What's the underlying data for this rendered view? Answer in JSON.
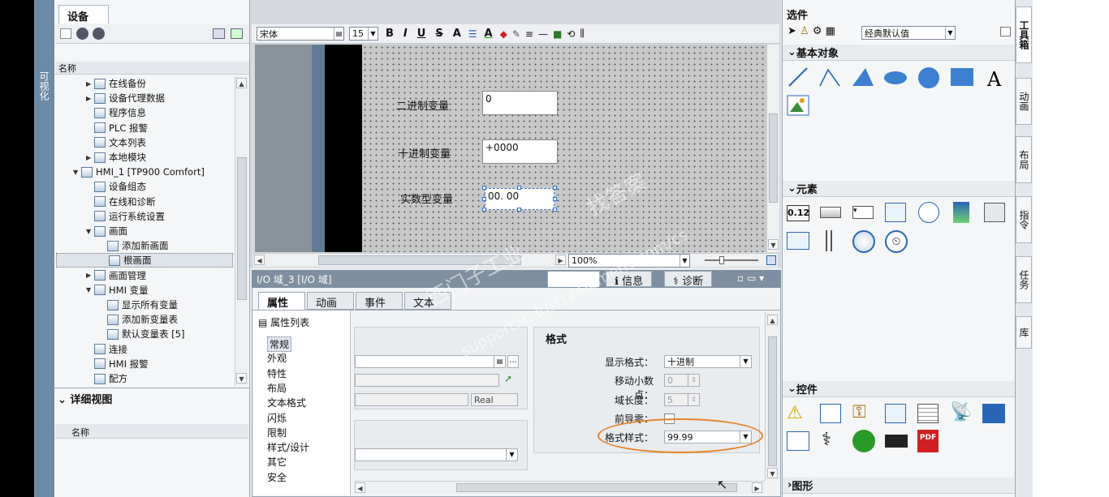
{
  "left_strip": {
    "label": "可视化"
  },
  "tree": {
    "tab": "设备",
    "column": "名称",
    "items": [
      {
        "label": "在线备份",
        "depth": 2,
        "arrow": "▶"
      },
      {
        "label": "设备代理数据",
        "depth": 2,
        "arrow": "▶"
      },
      {
        "label": "程序信息",
        "depth": 2,
        "arrow": ""
      },
      {
        "label": "PLC 报警",
        "depth": 2,
        "arrow": ""
      },
      {
        "label": "文本列表",
        "depth": 2,
        "arrow": ""
      },
      {
        "label": "本地模块",
        "depth": 2,
        "arrow": "▶"
      },
      {
        "label": "HMI_1 [TP900 Comfort]",
        "depth": 1,
        "arrow": "▼"
      },
      {
        "label": "设备组态",
        "depth": 2,
        "arrow": ""
      },
      {
        "label": "在线和诊断",
        "depth": 2,
        "arrow": ""
      },
      {
        "label": "运行系统设置",
        "depth": 2,
        "arrow": ""
      },
      {
        "label": "画面",
        "depth": 2,
        "arrow": "▼"
      },
      {
        "label": "添加新画面",
        "depth": 3,
        "arrow": ""
      },
      {
        "label": "根画面",
        "depth": 3,
        "arrow": ""
      },
      {
        "label": "画面管理",
        "depth": 2,
        "arrow": "▶"
      },
      {
        "label": "HMI 变量",
        "depth": 2,
        "arrow": "▼"
      },
      {
        "label": "显示所有变量",
        "depth": 3,
        "arrow": ""
      },
      {
        "label": "添加新变量表",
        "depth": 3,
        "arrow": ""
      },
      {
        "label": "默认变量表 [5]",
        "depth": 3,
        "arrow": ""
      },
      {
        "label": "连接",
        "depth": 2,
        "arrow": ""
      },
      {
        "label": "HMI 报警",
        "depth": 2,
        "arrow": ""
      },
      {
        "label": "配方",
        "depth": 2,
        "arrow": ""
      }
    ]
  },
  "detail": {
    "title": "详细视图",
    "column": "名称"
  },
  "format_bar": {
    "font": "宋体",
    "size": "15",
    "bold": "B",
    "italic": "I",
    "underline": "U",
    "strike": "S",
    "color_a": "A"
  },
  "canvas": {
    "labels": [
      "二进制变量",
      "十进制变量",
      "实数型变量"
    ],
    "values": [
      "0",
      "+0000",
      "00. 00"
    ],
    "zoom": "100%"
  },
  "inspector": {
    "title": "I/O 域_3 [I/O 域]",
    "right_tabs": [
      "属性",
      "信息",
      "诊断"
    ],
    "tabs": [
      "属性",
      "动画",
      "事件",
      "文本"
    ],
    "prop_list_title": "属性列表",
    "prop_list": [
      "常规",
      "外观",
      "特性",
      "布局",
      "文本格式",
      "闪烁",
      "限制",
      "样式/设计",
      "其它",
      "安全"
    ],
    "var_type": "Real",
    "format_section": "格式",
    "fields": [
      {
        "label": "显示格式：",
        "value": "十进制"
      },
      {
        "label": "移动小数点：",
        "value": "0"
      },
      {
        "label": "域长度：",
        "value": "5"
      },
      {
        "label": "前导零：",
        "value": ""
      },
      {
        "label": "格式样式：",
        "value": "99.99"
      }
    ]
  },
  "toolbox": {
    "options_title": "选件",
    "style_select": "经典默认值",
    "basic_objects": "基本对象",
    "elements": "元素",
    "controls": "控件",
    "graphics": "图形",
    "elem_text": "0.12"
  },
  "vtabs": [
    "工具箱",
    "动画",
    "布局",
    "指令",
    "任务",
    "库"
  ],
  "watermark": [
    "西门子工业",
    "找答案",
    "support.industry.siemens.com/cs"
  ],
  "accent": "#e8822a"
}
